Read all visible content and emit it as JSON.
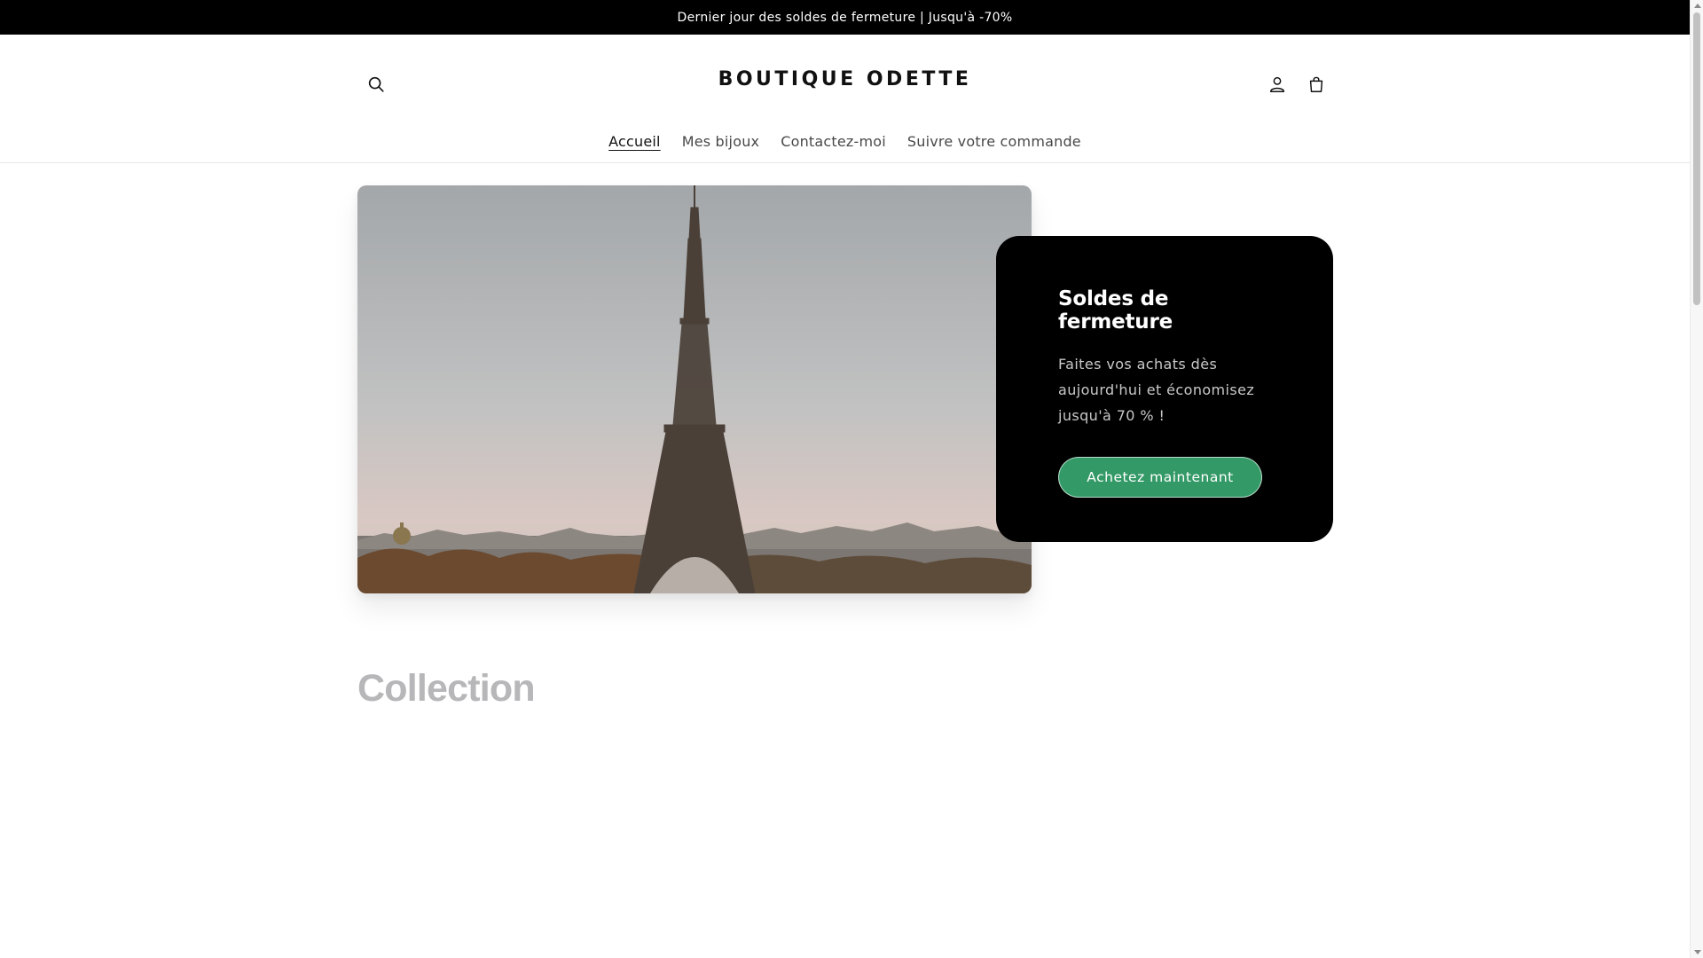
{
  "announcement": {
    "text": "Dernier jour des soldes de fermeture | Jusqu'à -70%"
  },
  "header": {
    "logo": "BOUTIQUE ODETTE",
    "icons": {
      "search": "search-icon",
      "account": "user-icon",
      "cart": "cart-icon"
    }
  },
  "nav": {
    "items": [
      {
        "label": "Accueil",
        "active": true
      },
      {
        "label": "Mes bijoux",
        "active": false
      },
      {
        "label": "Contactez-moi",
        "active": false
      },
      {
        "label": "Suivre votre commande",
        "active": false
      }
    ]
  },
  "hero": {
    "image": "eiffel-tower-photo",
    "title": "Soldes de fermeture",
    "text": "Faites vos achats dès aujourd'hui et économisez jusqu'à 70 % !",
    "button_label": "Achetez maintenant",
    "button_color": "#339966"
  },
  "collection": {
    "title": "Collection"
  }
}
